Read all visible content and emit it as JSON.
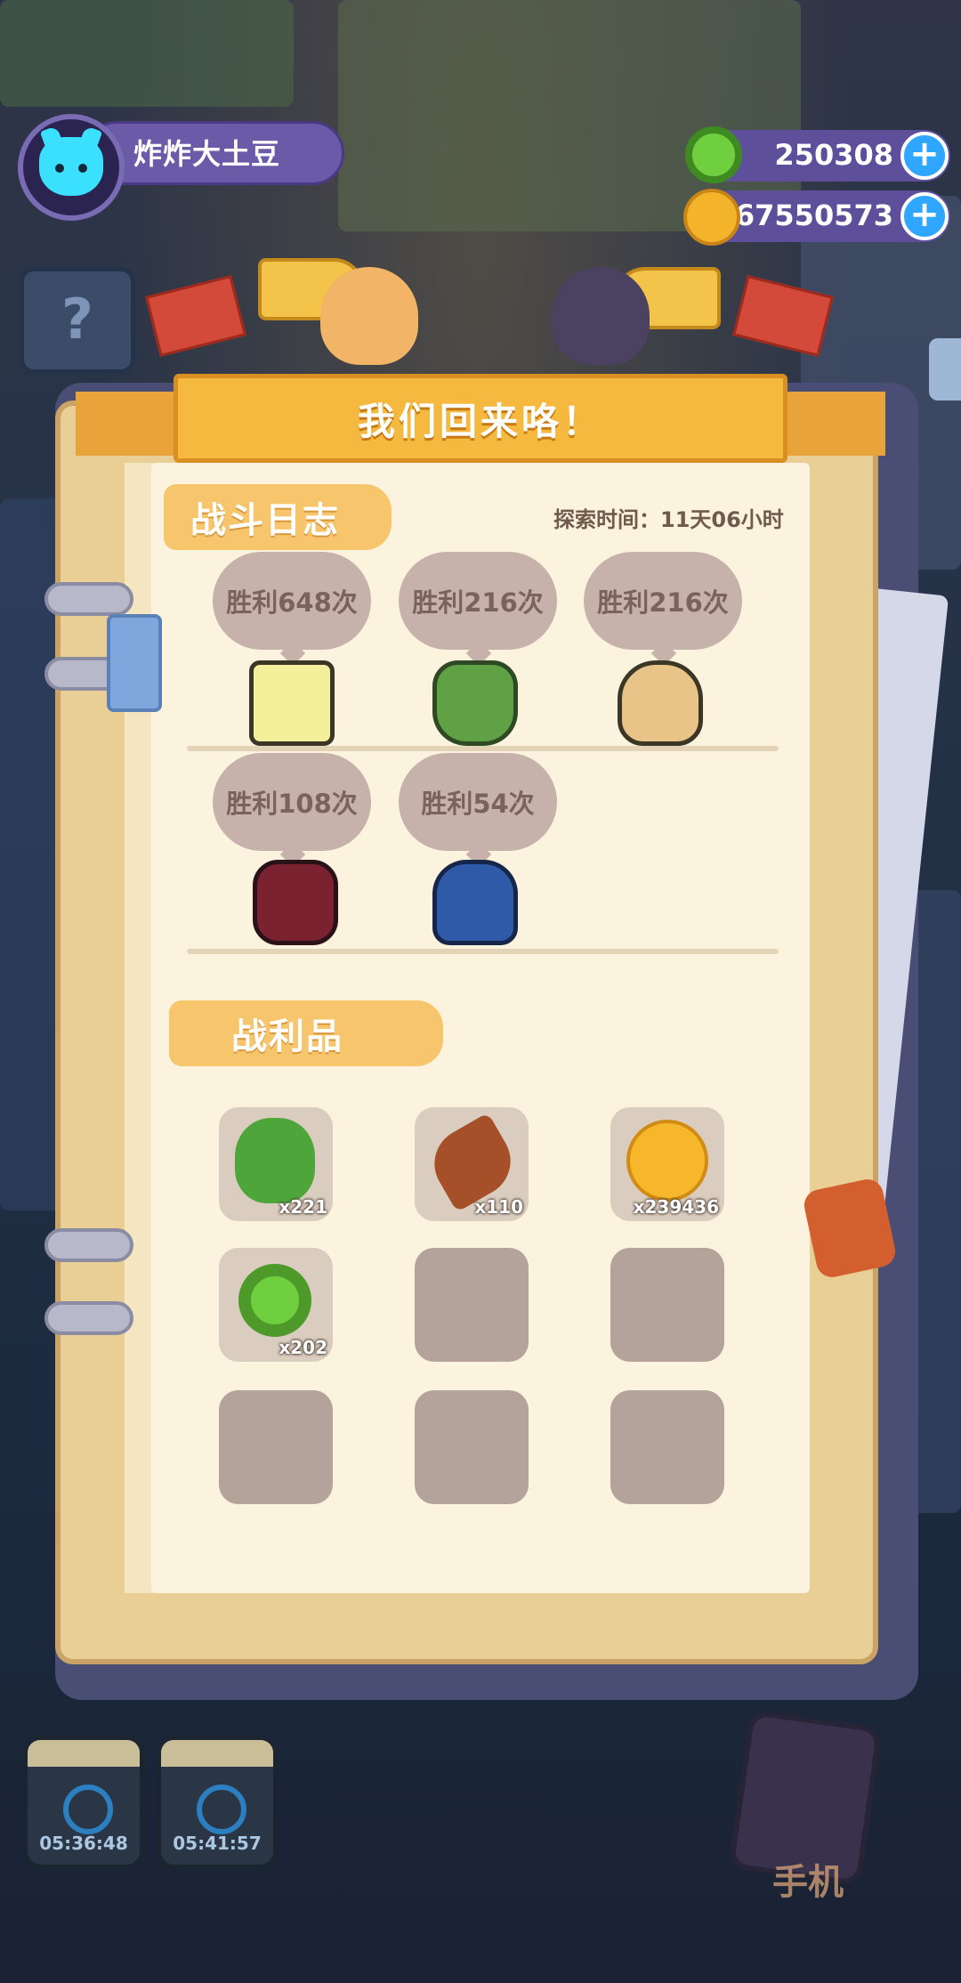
{
  "player": {
    "name": "炸炸大土豆"
  },
  "currencies": [
    {
      "name": "green-donut",
      "value": "250308",
      "color": "#6fcf3e"
    },
    {
      "name": "gold-planet",
      "value": "267550573",
      "color": "#f3b32a"
    }
  ],
  "dialog": {
    "title": "我们回来咯！"
  },
  "battle_log": {
    "heading": "战斗日志",
    "explore_time": "探索时间：11天06小时",
    "entries": [
      {
        "victories": "胜利648次",
        "monster": "tofu-block-monster"
      },
      {
        "victories": "胜利216次",
        "monster": "zongzi-red-hat-monster"
      },
      {
        "victories": "胜利216次",
        "monster": "zongzi-egg-monster"
      },
      {
        "victories": "胜利108次",
        "monster": "wine-jar-monster"
      },
      {
        "victories": "胜利54次",
        "monster": "kite-bird-monster"
      }
    ]
  },
  "loot": {
    "heading": "战利品",
    "items": [
      {
        "icon": "cilantro-icon",
        "qty": "x221"
      },
      {
        "icon": "sausage-icon",
        "qty": "x110"
      },
      {
        "icon": "gold-planet-icon",
        "qty": "x239436"
      },
      {
        "icon": "green-donut-icon",
        "qty": "x202"
      }
    ]
  },
  "hud": {
    "timers": [
      "05:36:48",
      "05:41:57"
    ],
    "phone_label": "手机",
    "help_glyph": "?"
  }
}
